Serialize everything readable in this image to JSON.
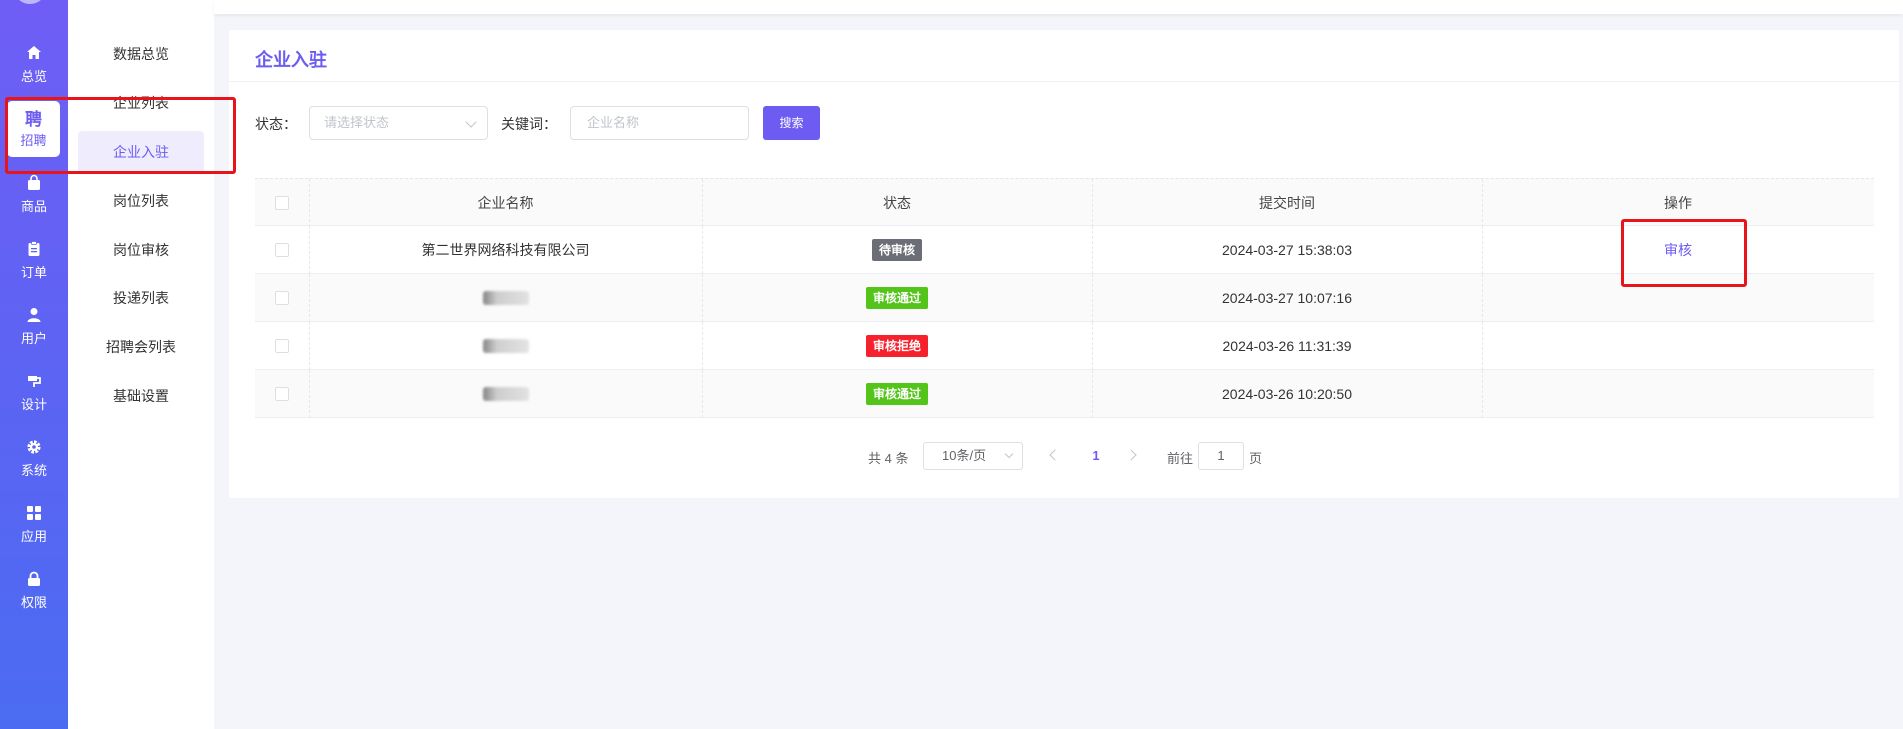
{
  "nav": {
    "items": [
      {
        "label": "总览",
        "icon": "home-icon"
      },
      {
        "label": "招聘",
        "icon": "recruit-icon",
        "glyph": "聘",
        "active": true
      },
      {
        "label": "商品",
        "icon": "bag-icon"
      },
      {
        "label": "订单",
        "icon": "clipboard-icon"
      },
      {
        "label": "用户",
        "icon": "user-icon"
      },
      {
        "label": "设计",
        "icon": "brush-icon"
      },
      {
        "label": "系统",
        "icon": "gear-icon"
      },
      {
        "label": "应用",
        "icon": "grid-icon"
      },
      {
        "label": "权限",
        "icon": "lock-icon"
      }
    ]
  },
  "subnav": {
    "items": [
      {
        "label": "数据总览"
      },
      {
        "label": "企业列表"
      },
      {
        "label": "企业入驻",
        "active": true
      },
      {
        "label": "岗位列表"
      },
      {
        "label": "岗位审核"
      },
      {
        "label": "投递列表"
      },
      {
        "label": "招聘会列表"
      },
      {
        "label": "基础设置"
      }
    ]
  },
  "page": {
    "title": "企业入驻"
  },
  "filters": {
    "status_label": "状态：",
    "status_placeholder": "请选择状态",
    "keyword_label": "关键词：",
    "keyword_placeholder": "企业名称",
    "search_button": "搜索"
  },
  "table": {
    "headers": [
      "企业名称",
      "状态",
      "提交时间",
      "操作"
    ],
    "rows": [
      {
        "company": "第二世界网络科技有限公司",
        "status": "待审核",
        "status_color": "#6b6e75",
        "time": "2024-03-27 15:38:03",
        "action": "审核"
      },
      {
        "company": "",
        "status": "审核通过",
        "status_color": "#52c41a",
        "time": "2024-03-27 10:07:16",
        "action": ""
      },
      {
        "company": "",
        "status": "审核拒绝",
        "status_color": "#f5222d",
        "time": "2024-03-26 11:31:39",
        "action": ""
      },
      {
        "company": "",
        "status": "审核通过",
        "status_color": "#52c41a",
        "time": "2024-03-26 10:20:50",
        "action": ""
      }
    ]
  },
  "pagination": {
    "total": "共 4 条",
    "page_size": "10条/页",
    "current_page": "1",
    "goto_label": "前往",
    "goto_value": "1",
    "page_unit": "页"
  },
  "colors": {
    "accent": "#6c5cf2",
    "annotation": "#e8141c"
  }
}
